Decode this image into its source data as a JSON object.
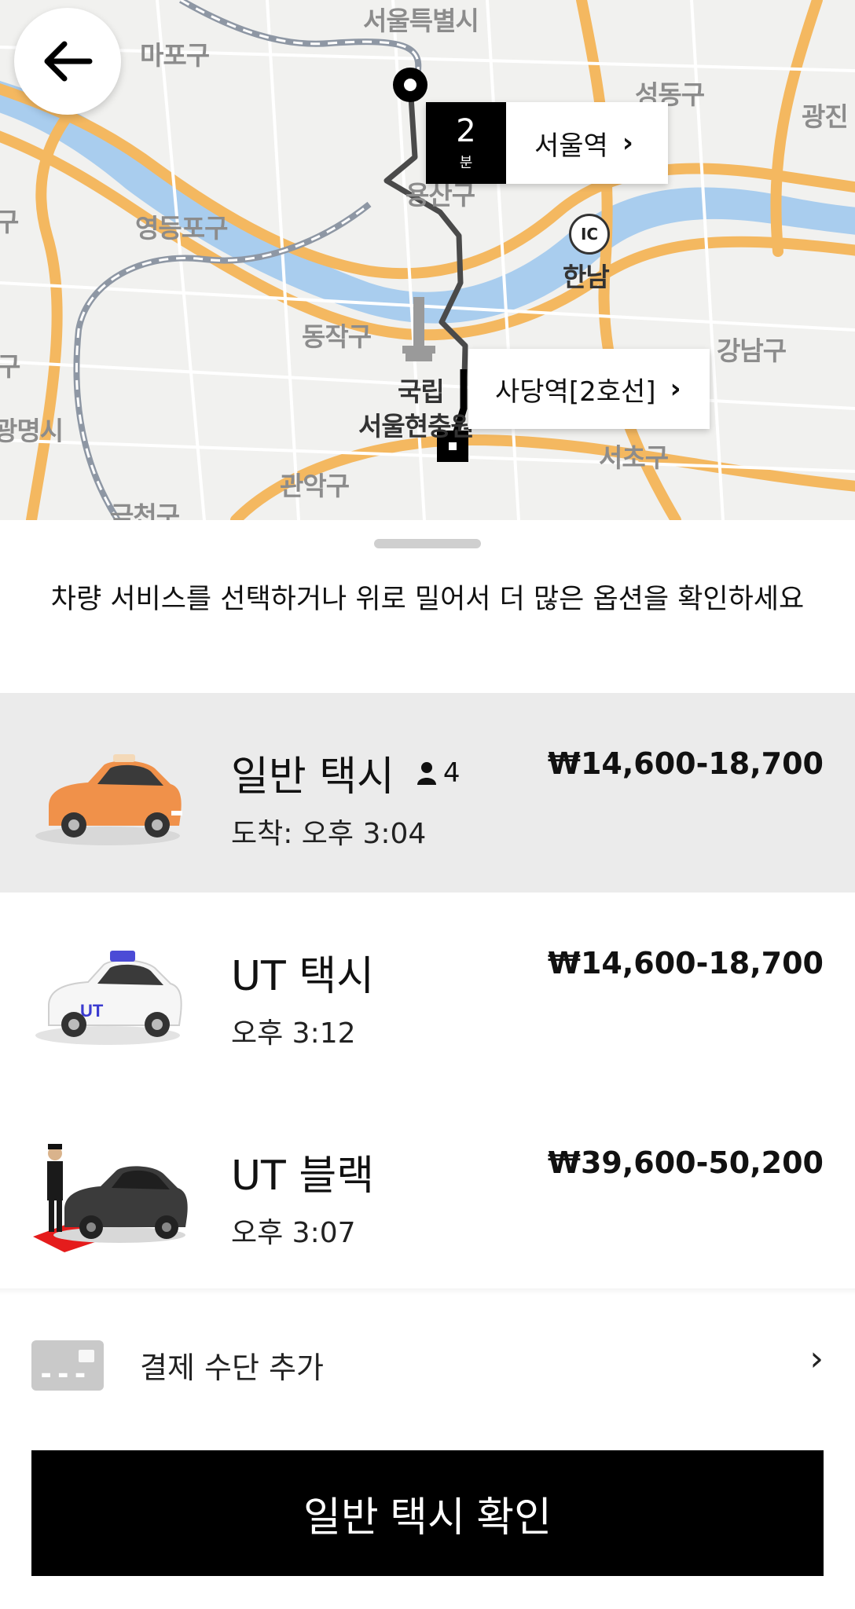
{
  "map": {
    "labels": {
      "seoul": "서울특별시",
      "mapo": "마포구",
      "seongdong": "성동구",
      "gwangjin": "광진",
      "yeongdeungpo": "영등포구",
      "dongjak": "동작구",
      "gangnam": "강남구",
      "seocho": "서초구",
      "gwanak": "관악구",
      "hannam": "한남",
      "national": "국립",
      "cemetery": "서울현충원",
      "yongsan": "용산구",
      "gwangmyeong": "광명시",
      "guro": "구",
      "guro2": "구",
      "geumcheon": "금천구"
    },
    "ic_badge": "IC",
    "eta": {
      "value": "2",
      "unit": "분",
      "pickup": "서울역"
    },
    "destination": "사당역[2호선]",
    "colors": {
      "water": "#a9cdee",
      "road": "#f4b860",
      "route": "#555555"
    }
  },
  "hint": "차량 서비스를 선택하거나 위로 밀어서 더 많은 옵션을 확인하세요",
  "rides": [
    {
      "name": "일반 택시",
      "capacity": "4",
      "time": "도착: 오후 3:04",
      "price": "₩14,600-18,700",
      "selected": true
    },
    {
      "name": "UT 택시",
      "time": "오후 3:12",
      "price": "₩14,600-18,700",
      "selected": false
    },
    {
      "name": "UT 블랙",
      "time": "오후 3:07",
      "price": "₩39,600-50,200",
      "selected": false
    }
  ],
  "payment": {
    "label": "결제 수단 추가",
    "icon": "credit-card-icon",
    "chevron": "›"
  },
  "confirm_button": "일반 택시 확인",
  "chevron": "›"
}
